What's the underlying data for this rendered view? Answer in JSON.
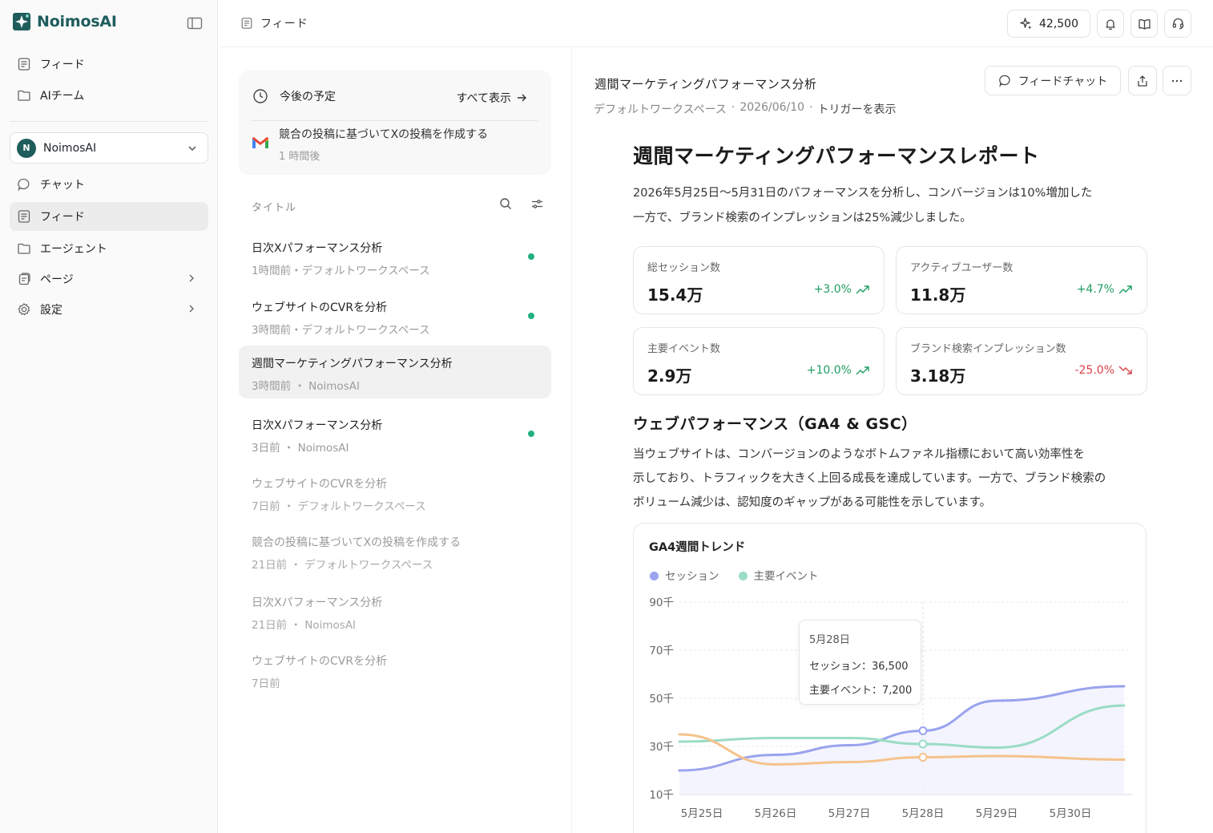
{
  "brand": {
    "name": "NoimosAI"
  },
  "sidebar": {
    "top_items": [
      {
        "label": "フィード",
        "icon": "feed-icon"
      },
      {
        "label": "AIチーム",
        "icon": "folder-icon"
      }
    ],
    "workspace": {
      "avatar": "N",
      "name": "NoimosAI"
    },
    "items": [
      {
        "label": "チャット",
        "icon": "chat-icon"
      },
      {
        "label": "フィード",
        "icon": "feed-icon",
        "active": true
      },
      {
        "label": "エージェント",
        "icon": "folder-icon"
      },
      {
        "label": "ページ",
        "icon": "pages-icon"
      },
      {
        "label": "設定",
        "icon": "gear-icon"
      }
    ]
  },
  "topbar": {
    "breadcrumb": "フィード",
    "credits": "42,500"
  },
  "upcoming": {
    "heading": "今後の予定",
    "view_all": "すべて表示",
    "item": {
      "title": "競合の投稿に基づいてXの投稿を作成する",
      "time": "1 時間後"
    }
  },
  "feed_list": {
    "column_header": "タイトル",
    "items": [
      {
        "title": "日次Xパフォーマンス分析",
        "sub": "1時間前・デフォルトワークスペース"
      },
      {
        "title": "ウェブサイトのCVRを分析",
        "sub": "3時間前・デフォルトワークスペース"
      },
      {
        "title": "週間マーケティングパフォーマンス分析",
        "sub": "3時間前 ・ NoimosAI"
      },
      {
        "title": "日次Xパフォーマンス分析",
        "sub": "3日前 ・ NoimosAI"
      },
      {
        "title": "ウェブサイトのCVRを分析",
        "sub": "7日前 ・ デフォルトワークスペース"
      },
      {
        "title": "競合の投稿に基づいてXの投稿を作成する",
        "sub": "21日前 ・ デフォルトワークスペース"
      },
      {
        "title": "日次Xパフォーマンス分析",
        "sub": "21日前 ・ NoimosAI"
      },
      {
        "title": "ウェブサイトのCVRを分析",
        "sub": "7日前"
      }
    ]
  },
  "report": {
    "header_title": "週間マーケティングパフォーマンス分析",
    "meta_workspace": "デフォルトワークスペース",
    "meta_date": "2026/06/10",
    "meta_trigger": "トリガーを表示",
    "feed_chat": "フィードチャット",
    "title": "週間マーケティングパフォーマンスレポート",
    "intro_line1": "2026年5月25日〜5月31日のパフォーマンスを分析し、コンバージョンは10%増加した",
    "intro_line2": "一方で、ブランド検索のインプレッションは25%減少しました。",
    "kpis": [
      {
        "label": "総セッション数",
        "value": "15.4万",
        "delta": "+3.0%",
        "trend": "up"
      },
      {
        "label": "アクティブユーザー数",
        "value": "11.8万",
        "delta": "+4.7%",
        "trend": "up"
      },
      {
        "label": "主要イベント数",
        "value": "2.9万",
        "delta": "+10.0%",
        "trend": "up"
      },
      {
        "label": "ブランド検索インプレッション数",
        "value": "3.18万",
        "delta": "-25.0%",
        "trend": "down"
      }
    ],
    "section_title": "ウェブパフォーマンス（GA4 & GSC）",
    "section_line1": "当ウェブサイトは、コンバージョンのようなボトムファネル指標において高い効率性を",
    "section_line2": "示しており、トラフィックを大きく上回る成長を達成しています。一方で、ブランド検索の",
    "section_line3": "ボリューム減少は、認知度のギャップがある可能性を示しています。",
    "tooltip": {
      "date": "5月28日",
      "line1": "セッション：36,500",
      "line2": "主要イベント：7,200"
    }
  },
  "chart_data": {
    "type": "line",
    "title": "GA4週間トレンド",
    "categories": [
      "5月25日",
      "5月26日",
      "5月27日",
      "5月28日",
      "5月29日",
      "5月30日"
    ],
    "y_ticks": [
      "90千",
      "70千",
      "50千",
      "30千",
      "10千"
    ],
    "ylim": [
      10000,
      90000
    ],
    "legend": "top-left",
    "grid": true,
    "series": [
      {
        "name": "セッション",
        "color": "#9aa3ee",
        "values": [
          20000,
          26500,
          30500,
          36500,
          49000,
          55000
        ]
      },
      {
        "name": "主要イベント",
        "color": "#9adcc4",
        "values": [
          32000,
          33500,
          33500,
          31000,
          29500,
          47000
        ]
      },
      {
        "name": "",
        "color": "#f5c28a",
        "values": [
          35000,
          22500,
          23500,
          25500,
          26000,
          24500
        ]
      }
    ]
  }
}
